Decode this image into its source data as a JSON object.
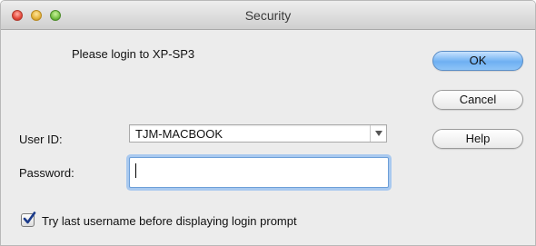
{
  "window": {
    "title": "Security"
  },
  "message": "Please login to XP-SP3",
  "form": {
    "user_label": "User ID:",
    "user_value": "TJM-MACBOOK",
    "password_label": "Password:",
    "password_value": ""
  },
  "buttons": {
    "ok": "OK",
    "cancel": "Cancel",
    "help": "Help"
  },
  "option": {
    "label": "Try last username before displaying login prompt",
    "checked": true
  },
  "icons": {
    "close": "close-icon",
    "minimize": "minimize-icon",
    "zoom": "zoom-icon",
    "dropdown": "chevron-down-icon",
    "check": "checkmark-icon"
  },
  "colors": {
    "default_button": "#6eb0f2",
    "focus_ring": "#a9c9ef",
    "checkmark": "#1a3a8a"
  }
}
